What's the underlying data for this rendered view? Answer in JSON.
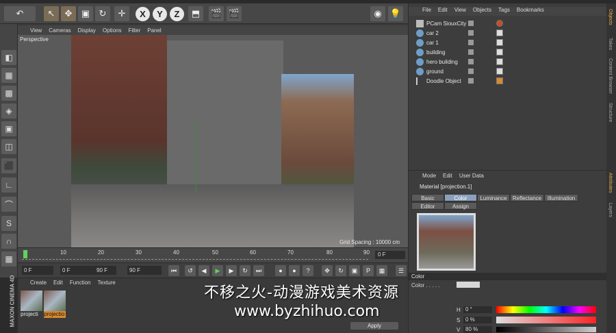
{
  "viewport": {
    "menu": [
      "View",
      "Cameras",
      "Display",
      "Options",
      "Filter",
      "Panel"
    ],
    "label": "Perspective",
    "grid_spacing": "Grid Spacing : 10000 cm"
  },
  "toolbar": {
    "x": "X",
    "y": "Y",
    "z": "Z"
  },
  "timeline": {
    "ticks": [
      "0",
      "10",
      "20",
      "30",
      "40",
      "50",
      "60",
      "70",
      "80",
      "90"
    ],
    "frame": "0 F"
  },
  "transport": {
    "start": "0 F",
    "current": "0 F",
    "end_a": "90 F",
    "end_b": "90 F"
  },
  "material_manager": {
    "menu": [
      "Create",
      "Edit",
      "Function",
      "Texture"
    ],
    "materials": [
      {
        "name": "projecti"
      },
      {
        "name": "projectio"
      }
    ],
    "apply_label": "Apply"
  },
  "branding": {
    "maxon": "MAXON CINEMA 4D"
  },
  "object_manager": {
    "menu": [
      "File",
      "Edit",
      "View",
      "Objects",
      "Tags",
      "Bookmarks"
    ],
    "objects": [
      {
        "name": "PCam SiouxCity"
      },
      {
        "name": "car 2"
      },
      {
        "name": "car 1"
      },
      {
        "name": "building"
      },
      {
        "name": "hero building"
      },
      {
        "name": "ground"
      },
      {
        "name": "Doodle Object"
      }
    ]
  },
  "side_tabs_top": [
    "Objects",
    "Takes",
    "Content Browser",
    "Structure"
  ],
  "side_tabs_bottom": [
    "Attributes",
    "Layers"
  ],
  "attributes": {
    "menu": [
      "Mode",
      "Edit",
      "User Data"
    ],
    "title": "Material [projection.1]",
    "tabs_row1": [
      "Basic",
      "Color",
      "Luminance",
      "Reflectance",
      "Illumination"
    ],
    "tabs_row2": [
      "Editor",
      "Assign"
    ],
    "active_tab": "Color",
    "section": "Color",
    "color_label": "Color . . . . .",
    "h_label": "H",
    "h_value": "0 °",
    "s_label": "S",
    "s_value": "0 %",
    "v_label": "V",
    "v_value": "80 %"
  },
  "watermark": {
    "line1": "不移之火-动漫游戏美术资源",
    "line2": "www.byzhihuo.com"
  }
}
